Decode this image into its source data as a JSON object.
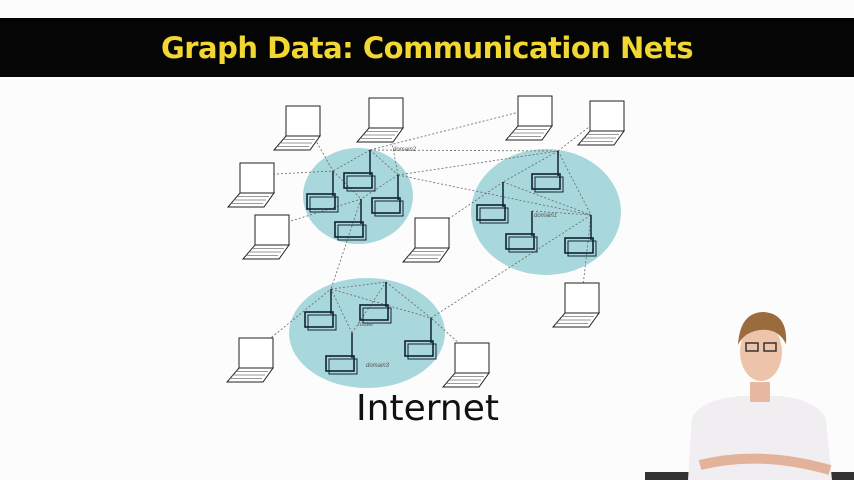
{
  "slide": {
    "title": "Graph Data: Communication Nets",
    "caption": "Internet",
    "title_color": "#f2d631",
    "domain_color": "#a9d8dc"
  },
  "diagram": {
    "labels": {
      "domain1": "domain1",
      "domain2": "domain2",
      "domain3": "domain3",
      "router": "router"
    },
    "icons": [
      "router-icon",
      "laptop-icon"
    ]
  }
}
